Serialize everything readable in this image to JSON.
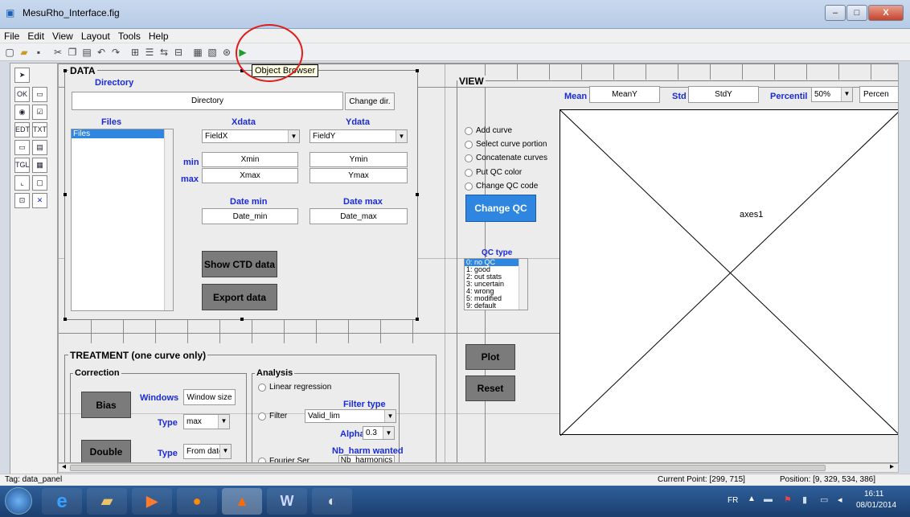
{
  "window": {
    "title": "MesuRho_Interface.fig",
    "min": "–",
    "max": "□",
    "close": "X"
  },
  "menu": [
    "File",
    "Edit",
    "View",
    "Layout",
    "Tools",
    "Help"
  ],
  "tooltip": "Object Browser",
  "data_panel": {
    "title": "DATA",
    "directory_label": "Directory",
    "directory_value": "Directory",
    "change_dir": "Change dir.",
    "files_label": "Files",
    "files_list": [
      "Files"
    ],
    "xdata_label": "Xdata",
    "ydata_label": "Ydata",
    "xdata_value": "FieldX",
    "ydata_value": "FieldY",
    "min_label": "min",
    "max_label": "max",
    "xmin": "Xmin",
    "ymin": "Ymin",
    "xmax": "Xmax",
    "ymax": "Ymax",
    "date_min_label": "Date min",
    "date_max_label": "Date max",
    "date_min": "Date_min",
    "date_max": "Date_max",
    "show_ctd": "Show CTD data",
    "export": "Export data"
  },
  "treatment_panel": {
    "title": "TREATMENT (one curve only)",
    "correction_title": "Correction",
    "bias": "Bias",
    "windows_label": "Windows",
    "window_size": "Window size",
    "type_label": "Type",
    "type_value": "max",
    "double": "Double",
    "type_label2": "Type",
    "type_value2": "From date",
    "analysis_title": "Analysis",
    "linear_regression": "Linear regression",
    "filter_type_label": "Filter type",
    "filter": "Filter",
    "filter_value": "Valid_lim",
    "alpha_label": "Alpha",
    "alpha_value": "0.3",
    "nb_harm_label": "Nb_harm wanted",
    "fourier": "Fourier Ser",
    "nb_harm_value": "Nb_harmonics"
  },
  "view_panel": {
    "title": "VIEW",
    "mean_label": "Mean",
    "mean_value": "MeanY",
    "std_label": "Std",
    "std_value": "StdY",
    "percentil_label": "Percentil",
    "percentil_value": "50%",
    "percen_field": "Percen",
    "options": [
      "Add curve",
      "Select curve portion",
      "Concatenate curves",
      "Put QC color",
      "Change QC code"
    ],
    "change_qc": "Change QC",
    "qc_type_label": "QC type",
    "qc_list": [
      "0: no QC",
      "1: good",
      "2: out stats",
      "3: uncertain",
      "4: wrong",
      "5: modified",
      "9: default"
    ],
    "plot": "Plot",
    "reset": "Reset",
    "axes_label": "axes1"
  },
  "status": {
    "tag": "Tag: data_panel",
    "current_point": "Current Point:  [299, 715]",
    "position": "Position: [9, 329, 534, 386]"
  },
  "taskbar": {
    "lang": "FR",
    "time": "16:11",
    "date": "08/01/2014"
  },
  "colors": {
    "accent_blue": "#1a2bd6",
    "button_blue": "#2f86e0",
    "button_gray": "#7b7b7b",
    "highlight": "#e01b1b"
  }
}
